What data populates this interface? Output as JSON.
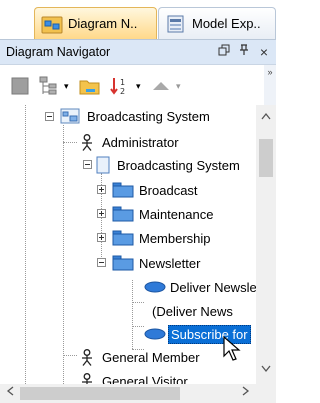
{
  "tabs": [
    {
      "label": "Diagram N..",
      "icon": "diagram-navigator-icon",
      "active": true
    },
    {
      "label": "Model Exp..",
      "icon": "model-explorer-icon",
      "active": false
    }
  ],
  "panel": {
    "title": "Diagram Navigator",
    "buttons": {
      "restore": "🗗",
      "pin": "📌",
      "close": "×"
    }
  },
  "tree": {
    "root": "Broadcasting System",
    "items": [
      {
        "label": "Administrator",
        "icon": "actor-icon"
      },
      {
        "label": "Broadcasting System",
        "icon": "system-icon"
      },
      {
        "label": "Broadcast",
        "icon": "package-icon"
      },
      {
        "label": "Maintenance",
        "icon": "package-icon"
      },
      {
        "label": "Membership",
        "icon": "package-icon"
      },
      {
        "label": "Newsletter",
        "icon": "package-icon"
      },
      {
        "label": "Deliver Newsle",
        "icon": "use-case-icon"
      },
      {
        "label": "(Deliver News",
        "icon": "use-case-icon"
      },
      {
        "label": "Subscribe for",
        "icon": "use-case-icon",
        "selected": true
      },
      {
        "label": "General Member",
        "icon": "actor-icon"
      },
      {
        "label": "General Visitor",
        "icon": "actor-icon"
      }
    ]
  },
  "colors": {
    "selection": "#0a6fd6",
    "header": "#dbe7f6",
    "active_tab": "#ffd98a"
  }
}
